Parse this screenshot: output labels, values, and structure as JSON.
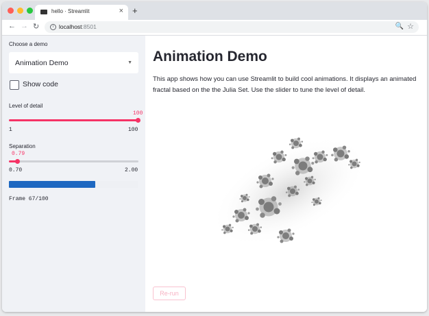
{
  "browser": {
    "tab_title": "hello · Streamlit",
    "tab_close": "×",
    "new_tab": "+",
    "url_host": "localhost",
    "url_port": ":8501",
    "nav_back": "←",
    "nav_forward": "→",
    "nav_reload": "↻",
    "zoom_icon": "🔍",
    "star_icon": "☆"
  },
  "sidebar": {
    "demo_label": "Choose a demo",
    "demo_value": "Animation Demo",
    "show_code_label": "Show code",
    "show_code_checked": false,
    "detail_slider": {
      "label": "Level of detail",
      "value": "100",
      "min": "1",
      "max": "100"
    },
    "separation_slider": {
      "label": "Separation",
      "value": "0.79",
      "min": "0.70",
      "max": "2.00"
    },
    "progress": {
      "fraction": 0.67
    },
    "frame_text": "Frame 67/100"
  },
  "main": {
    "title": "Animation Demo",
    "description": "This app shows how you can use Streamlit to build cool animations. It displays an animated fractal based on the the Julia Set. Use the slider to tune the level of detail.",
    "rerun_label": "Re-run"
  },
  "colors": {
    "accent": "#f63366",
    "progress": "#1e68c1",
    "sidebar_bg": "#f0f2f6"
  }
}
